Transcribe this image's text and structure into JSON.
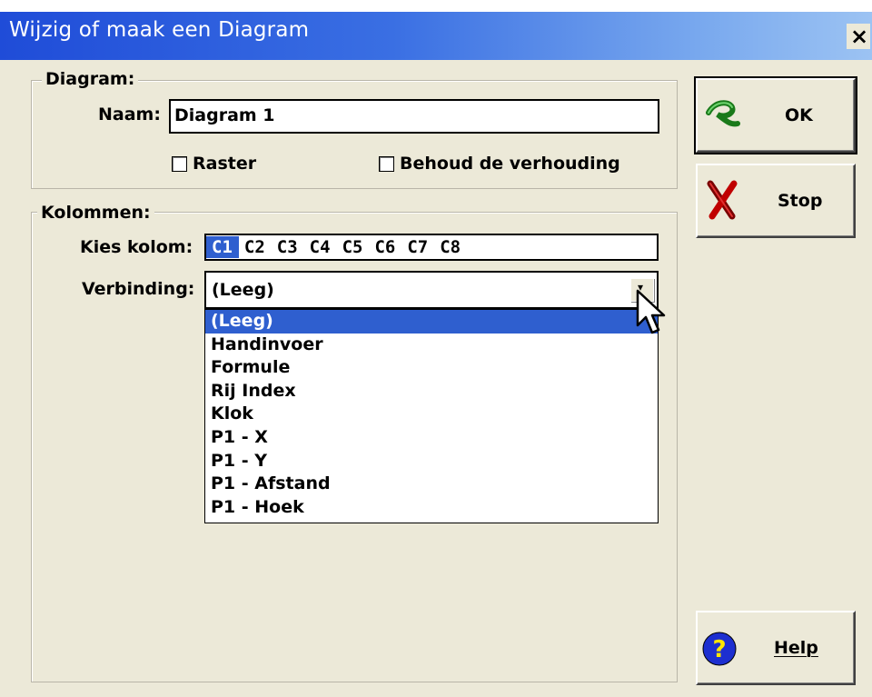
{
  "window": {
    "title": "Wijzig of maak een Diagram",
    "close_symbol": "×"
  },
  "diagram_group": {
    "label": "Diagram:",
    "name_label": "Naam:",
    "name_value": "Diagram 1",
    "grid_checkbox_label": "Raster",
    "grid_checked": false,
    "ratio_checkbox_label": "Behoud de verhouding",
    "ratio_checked": false
  },
  "columns_group": {
    "label": "Kolommen:",
    "choose_column_label": "Kies kolom:",
    "columns": [
      "C1",
      "C2",
      "C3",
      "C4",
      "C5",
      "C6",
      "C7",
      "C8"
    ],
    "selected_column": "C1",
    "connection_label": "Verbinding:",
    "connection_value": "(Leeg)",
    "connection_options": [
      "(Leeg)",
      "Handinvoer",
      "Formule",
      "Rij Index",
      "Klok",
      "P1 - X",
      "P1 - Y",
      "P1 - Afstand",
      "P1 - Hoek"
    ],
    "highlighted_option": "(Leeg)"
  },
  "buttons": {
    "ok_label": "OK",
    "stop_label": "Stop",
    "help_label": "Help",
    "ok_icon": "green-check-icon",
    "stop_icon": "red-x-icon",
    "help_icon": "question-icon"
  },
  "colors": {
    "title_bar": "#1f4cd8",
    "selection": "#2f5fcf",
    "dialog_face": "#ece9d8"
  }
}
